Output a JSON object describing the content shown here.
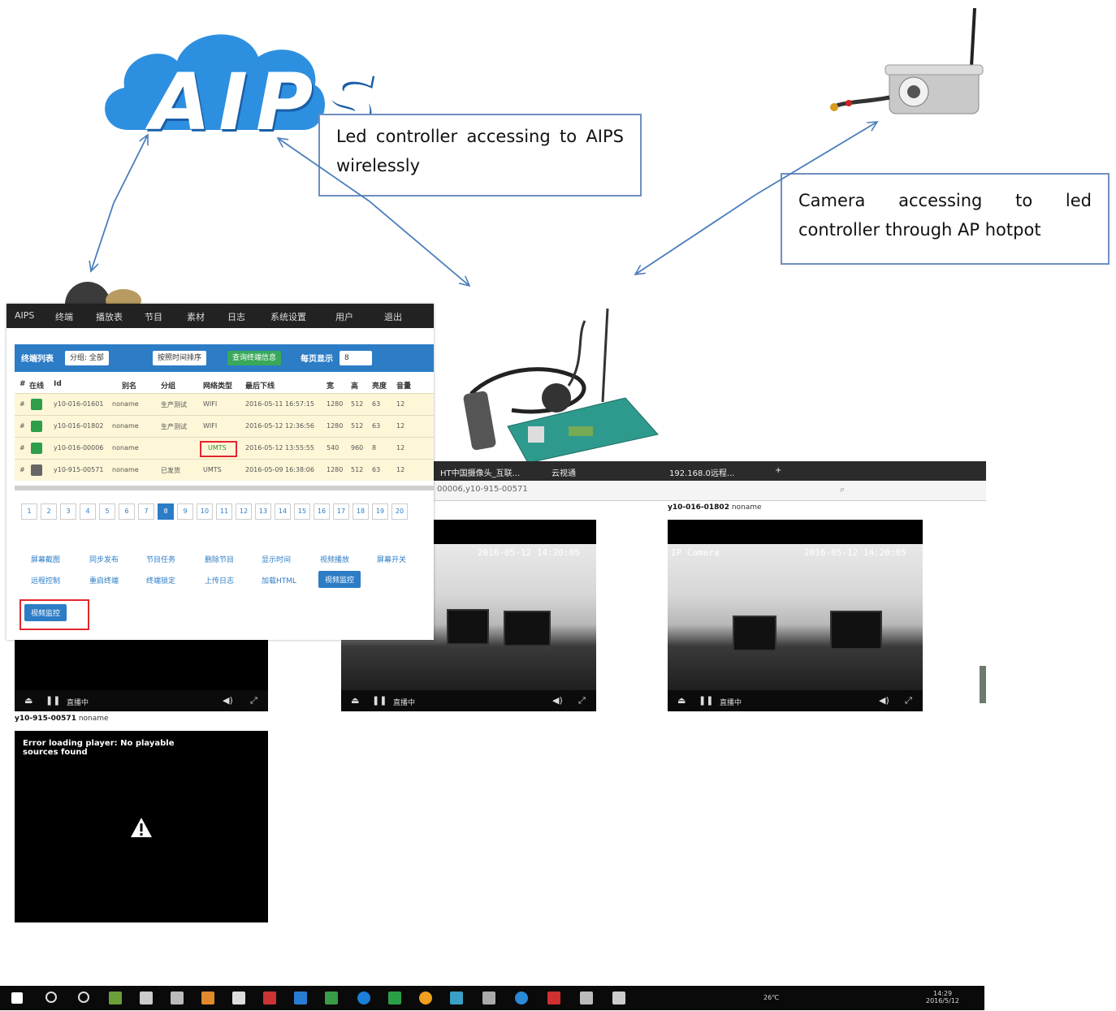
{
  "callouts": {
    "led_controller_text": "Led controller accessing to AIPS wirelessly",
    "camera_text": "Camera accessing to led controller through AP hotpot"
  },
  "logo": {
    "text": "AIPS",
    "cloud_color": "#2d8fe0"
  },
  "admin": {
    "nav": [
      "AIPS",
      "终端",
      "播放表",
      "节目",
      "素材",
      "日志",
      "系统设置",
      "用户",
      "退出"
    ],
    "toolbar": {
      "group_label": "终端列表",
      "filter": "分组: 全部",
      "select_button": "按照时间排序",
      "refresh_button": "查询终端信息",
      "per_page_label": "每页显示",
      "per_page_value": "8"
    },
    "columns": [
      "#",
      "在线",
      "Id",
      "别名",
      "分组",
      "网络类型",
      "最后下线",
      "宽",
      "高",
      "亮度",
      "音量"
    ],
    "rows": [
      {
        "id": "y10-016-01601",
        "alias": "noname",
        "group": "生产测试",
        "network": "WIFI",
        "last": "2016-05-11 16:57:15",
        "w": "1280",
        "h": "512",
        "b": "63",
        "v": "12"
      },
      {
        "id": "y10-016-01802",
        "alias": "noname",
        "group": "生产测试",
        "network": "WIFI",
        "last": "2016-05-12 12:36:56",
        "w": "1280",
        "h": "512",
        "b": "63",
        "v": "12"
      },
      {
        "id": "y10-016-00006",
        "alias": "noname",
        "group": "",
        "network": "UMTS",
        "last": "2016-05-12 13:55:55",
        "w": "540",
        "h": "960",
        "b": "8",
        "v": "12"
      },
      {
        "id": "y10-915-00571",
        "alias": "noname",
        "group": "已发货",
        "network": "UMTS",
        "last": "2016-05-09 16:38:06",
        "w": "1280",
        "h": "512",
        "b": "63",
        "v": "12"
      }
    ],
    "pages": [
      "1",
      "2",
      "3",
      "4",
      "5",
      "6",
      "7",
      "8",
      "9",
      "10",
      "11",
      "12",
      "13",
      "14",
      "15",
      "16",
      "17",
      "18",
      "19",
      "20"
    ],
    "active_page": "8",
    "functions_row1": [
      "屏幕截图",
      "同步发布",
      "节目任务",
      "删除节目",
      "显示时间",
      "视频播放",
      "屏幕开关"
    ],
    "functions_row2": [
      "远程控制",
      "重启终端",
      "终端锁定",
      "上传日志",
      "加载HTML",
      "视频监控"
    ],
    "monitor_button": "视频监控"
  },
  "browser": {
    "tabs": [
      "HT中国摄像头_互联...",
      "云视通",
      "192.168.0远程..."
    ],
    "url": "00006,y10-915-00571"
  },
  "videos": [
    {
      "label_id": "",
      "label_name": "",
      "timestamp": "2016-05-12 14:20:05",
      "cam": "",
      "status": "直播中"
    },
    {
      "label_id": "y10-016-01802",
      "label_name": "noname",
      "timestamp": "2016-05-12 14:20:05",
      "cam": "IP Camera",
      "status": "直播中"
    },
    {
      "label_id": "y10-915-00571",
      "label_name": "noname",
      "timestamp": "",
      "cam": "",
      "status": "直播中"
    }
  ],
  "error": {
    "message": "Error loading player: No playable sources found"
  },
  "taskbar": {
    "time": "14:29",
    "date": "2016/5/12",
    "weather": "26℃"
  }
}
